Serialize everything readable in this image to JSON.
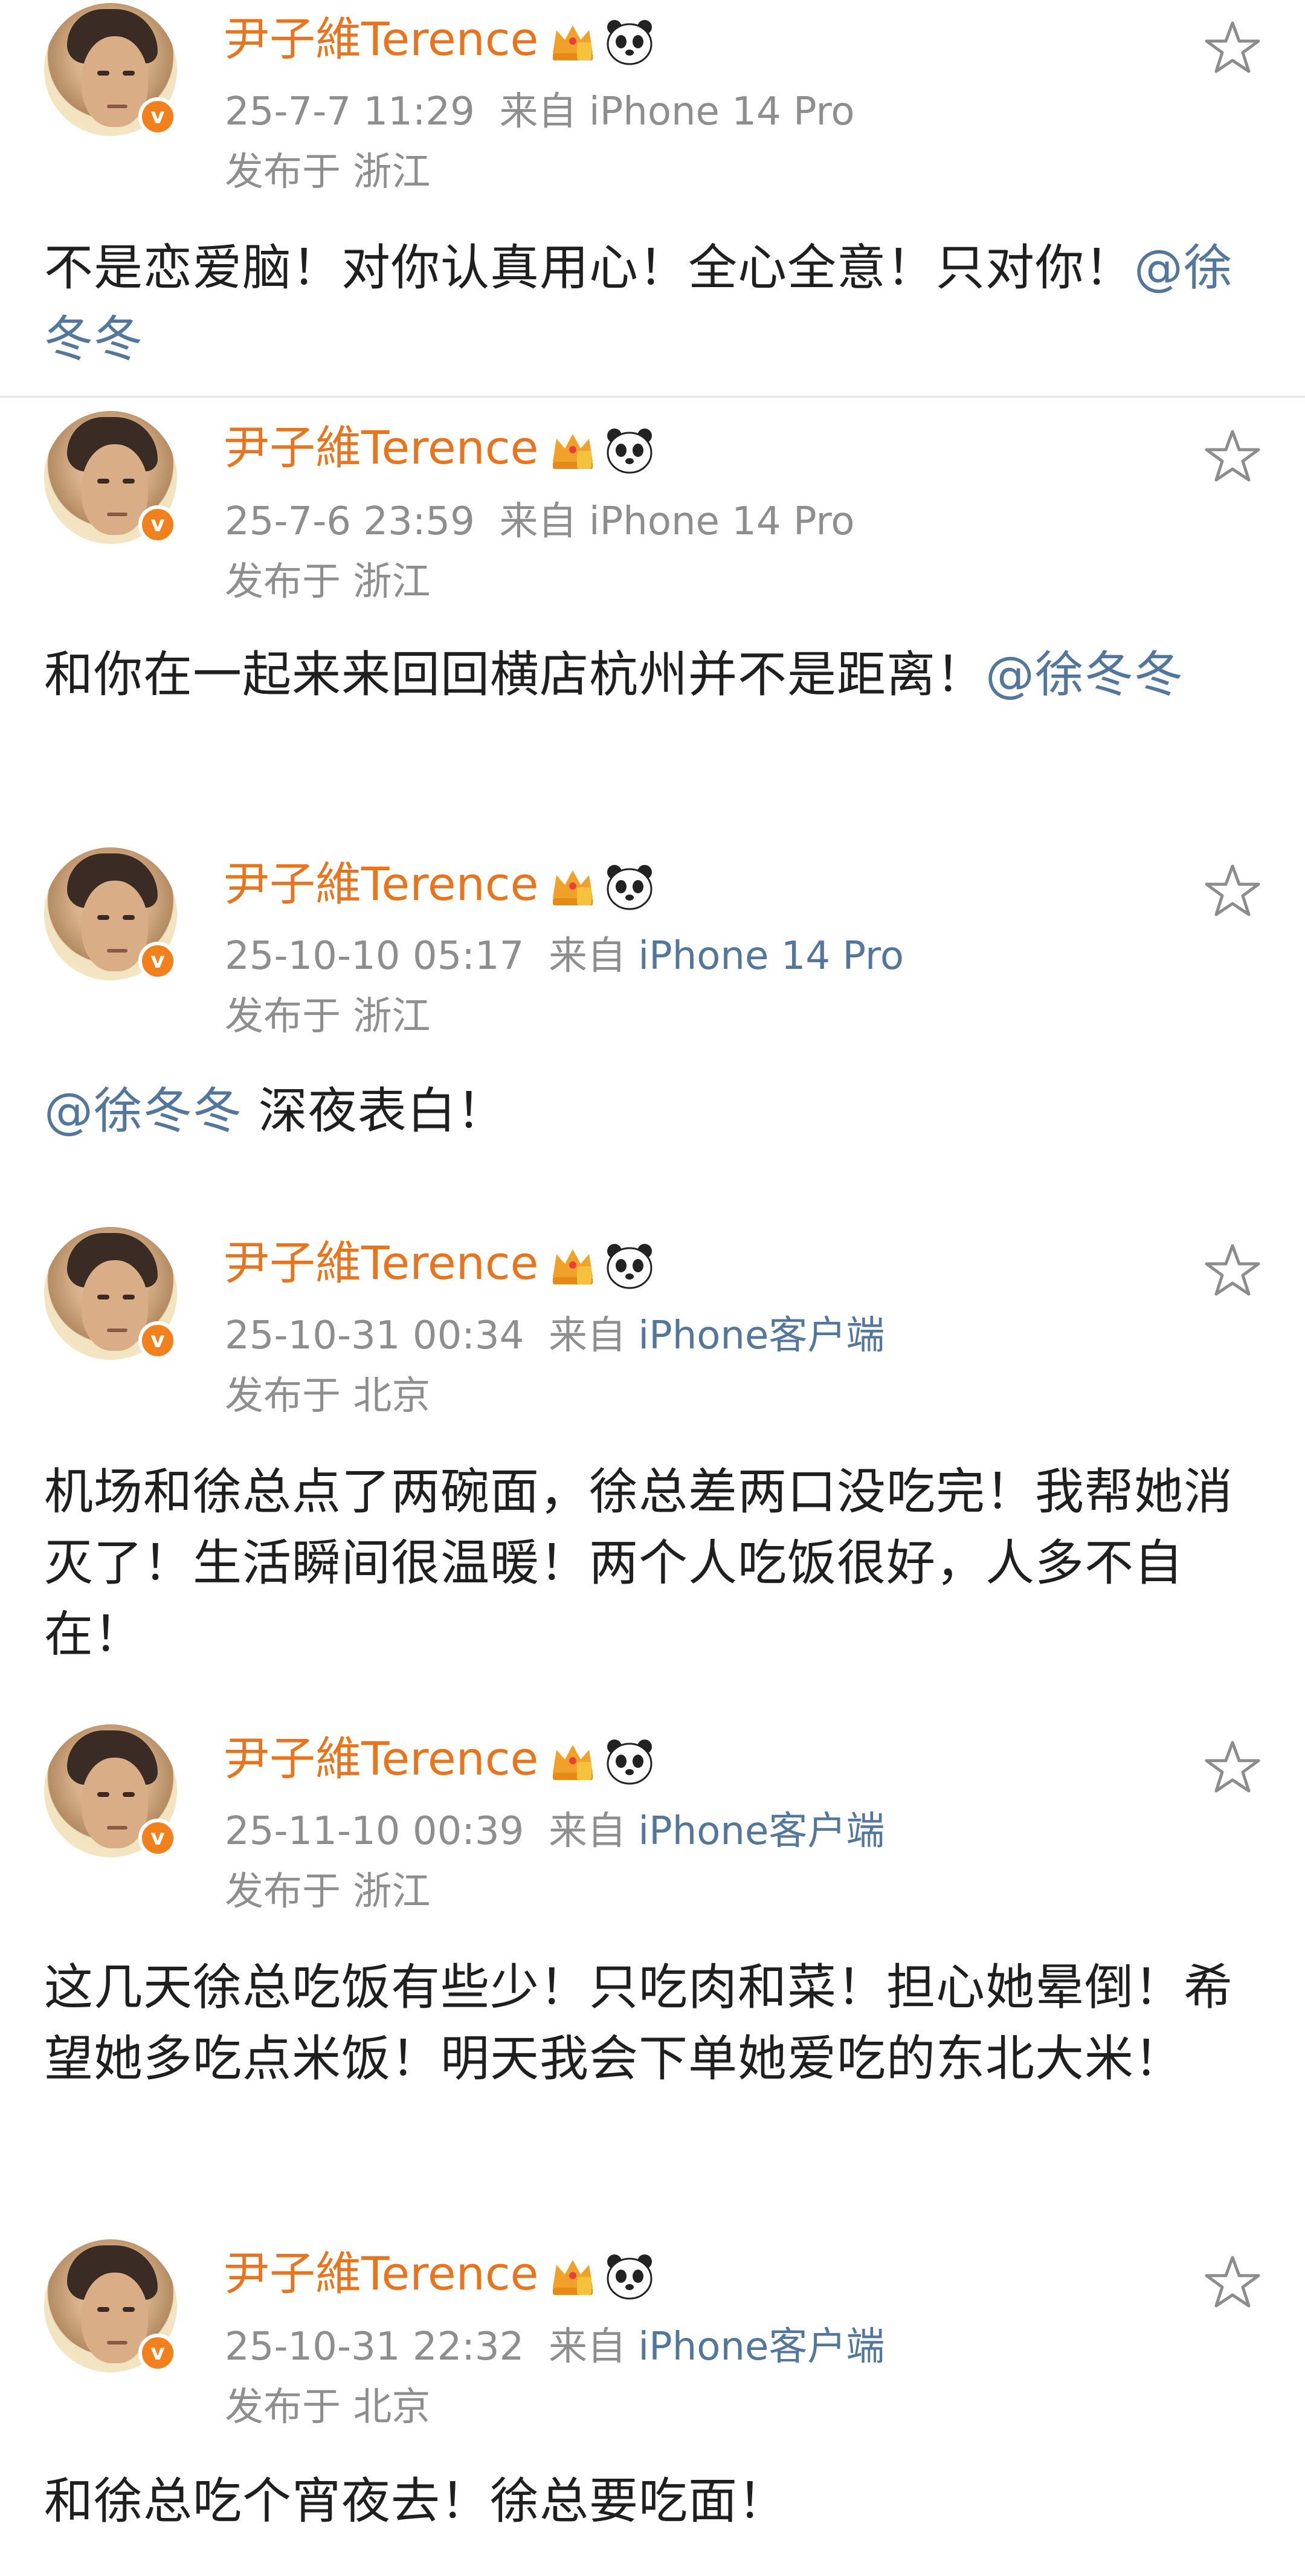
{
  "colors": {
    "username": "#e8741e",
    "meta": "#8e8e8e",
    "link": "#53779c",
    "badge": "#f2811d"
  },
  "icons": {
    "crown": "crown-badge-icon",
    "panda": "panda-icon",
    "star": "star-outline-icon",
    "verified": "verified-v-badge"
  },
  "posts": [
    {
      "username": "尹子維Terence",
      "verified_badge": "v",
      "time": "25-7-7 11:29",
      "source_prefix": "来自",
      "source": "iPhone 14 Pro",
      "location": "发布于 浙江",
      "content_a": "不是恋爱脑！对你认真用心！全心全意！只对你！",
      "mention_a": "@徐冬冬",
      "content_b": ""
    },
    {
      "username": "尹子維Terence",
      "verified_badge": "v",
      "time": "25-7-6 23:59",
      "source_prefix": "来自",
      "source": "iPhone 14 Pro",
      "location": "发布于 浙江",
      "content_a": "和你在一起来来回回横店杭州并不是距离！",
      "mention_a": "@徐冬冬",
      "content_b": ""
    },
    {
      "username": "尹子維Terence",
      "verified_badge": "v",
      "time": "25-10-10 05:17",
      "source_prefix": "来自",
      "source": "iPhone 14 Pro",
      "location": "发布于 浙江",
      "mention_a": "@徐冬冬",
      "content_a": " 深夜表白！",
      "content_b": ""
    },
    {
      "username": "尹子維Terence",
      "verified_badge": "v",
      "time": "25-10-31 00:34",
      "source_prefix": "来自",
      "source": "iPhone客户端",
      "location": "发布于 北京",
      "content_a": "机场和徐总点了两碗面，徐总差两口没吃完！我帮她消灭了！生活瞬间很温暖！两个人吃饭很好，人多不自在！",
      "mention_a": "",
      "content_b": ""
    },
    {
      "username": "尹子維Terence",
      "verified_badge": "v",
      "time": "25-11-10 00:39",
      "source_prefix": "来自",
      "source": "iPhone客户端",
      "location": "发布于 浙江",
      "content_a": "这几天徐总吃饭有些少！只吃肉和菜！担心她晕倒！希望她多吃点米饭！明天我会下单她爱吃的东北大米！",
      "mention_a": "",
      "content_b": ""
    },
    {
      "username": "尹子維Terence",
      "verified_badge": "v",
      "time": "25-10-31 22:32",
      "source_prefix": "来自",
      "source": "iPhone客户端",
      "location": "发布于 北京",
      "content_a": "和徐总吃个宵夜去！徐总要吃面！",
      "mention_a": "",
      "content_b": ""
    }
  ]
}
